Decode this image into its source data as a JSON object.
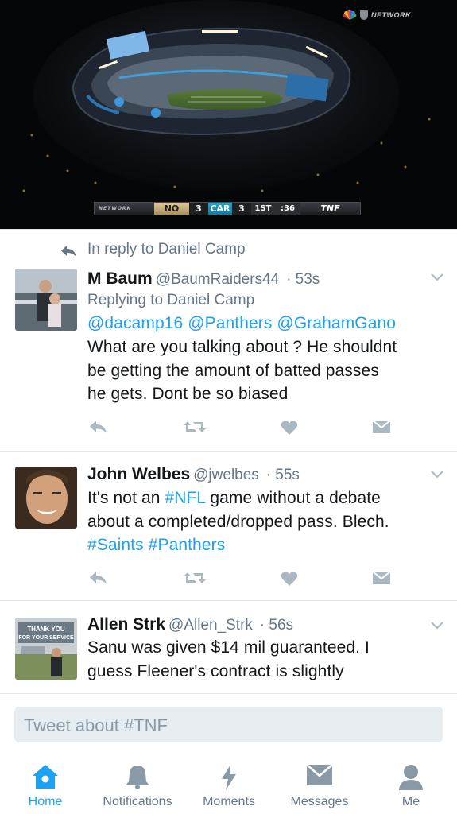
{
  "video": {
    "network_label": "NETWORK",
    "scorebug": {
      "network": "NETWORK",
      "team1": "NO",
      "team1_score": "3",
      "team2": "CAR",
      "team2_score": "3",
      "quarter": "1ST",
      "clock": ":36",
      "show": "TNF"
    }
  },
  "in_reply": {
    "text": "In reply to Daniel Camp",
    "icon": "reply-arrow-icon"
  },
  "tweets": [
    {
      "name": "M Baum",
      "handle": "@BaumRaiders44",
      "time": "· 53s",
      "replying_to": "Replying to Daniel Camp",
      "mentions": "@dacamp16 @Panthers @GrahamGano",
      "lines": [
        "What are you talking about ? He shouldnt",
        "be getting the amount of batted passes",
        "he gets. Dont be so biased"
      ]
    },
    {
      "name": "John Welbes",
      "handle": "@jwelbes",
      "time": "· 55s",
      "line1_pre": "It's not an ",
      "line1_tag": "#NFL",
      "line1_post": " game without a debate",
      "line2": "about a completed/dropped pass. Blech.",
      "line3_tags": "#Saints #Panthers"
    },
    {
      "name": "Allen Strk",
      "handle": "@Allen_Strk",
      "time": "· 56s",
      "avatar_sign": "THANK YOU FOR YOUR SERVICE",
      "lines": [
        "Sanu was given $14 mil guaranteed. I",
        "guess Fleener's contract is slightly"
      ]
    }
  ],
  "composer": {
    "placeholder": "Tweet about #TNF"
  },
  "tabs": [
    {
      "label": "Home",
      "icon": "home-icon",
      "active": true
    },
    {
      "label": "Notifications",
      "icon": "bell-icon",
      "active": false
    },
    {
      "label": "Moments",
      "icon": "lightning-icon",
      "active": false
    },
    {
      "label": "Messages",
      "icon": "envelope-icon",
      "active": false
    },
    {
      "label": "Me",
      "icon": "person-icon",
      "active": false
    }
  ],
  "colors": {
    "accent": "#1da1f2",
    "secondary_text": "#657786",
    "icon_gray": "#aab8c2",
    "divider": "#e1e8ed"
  }
}
